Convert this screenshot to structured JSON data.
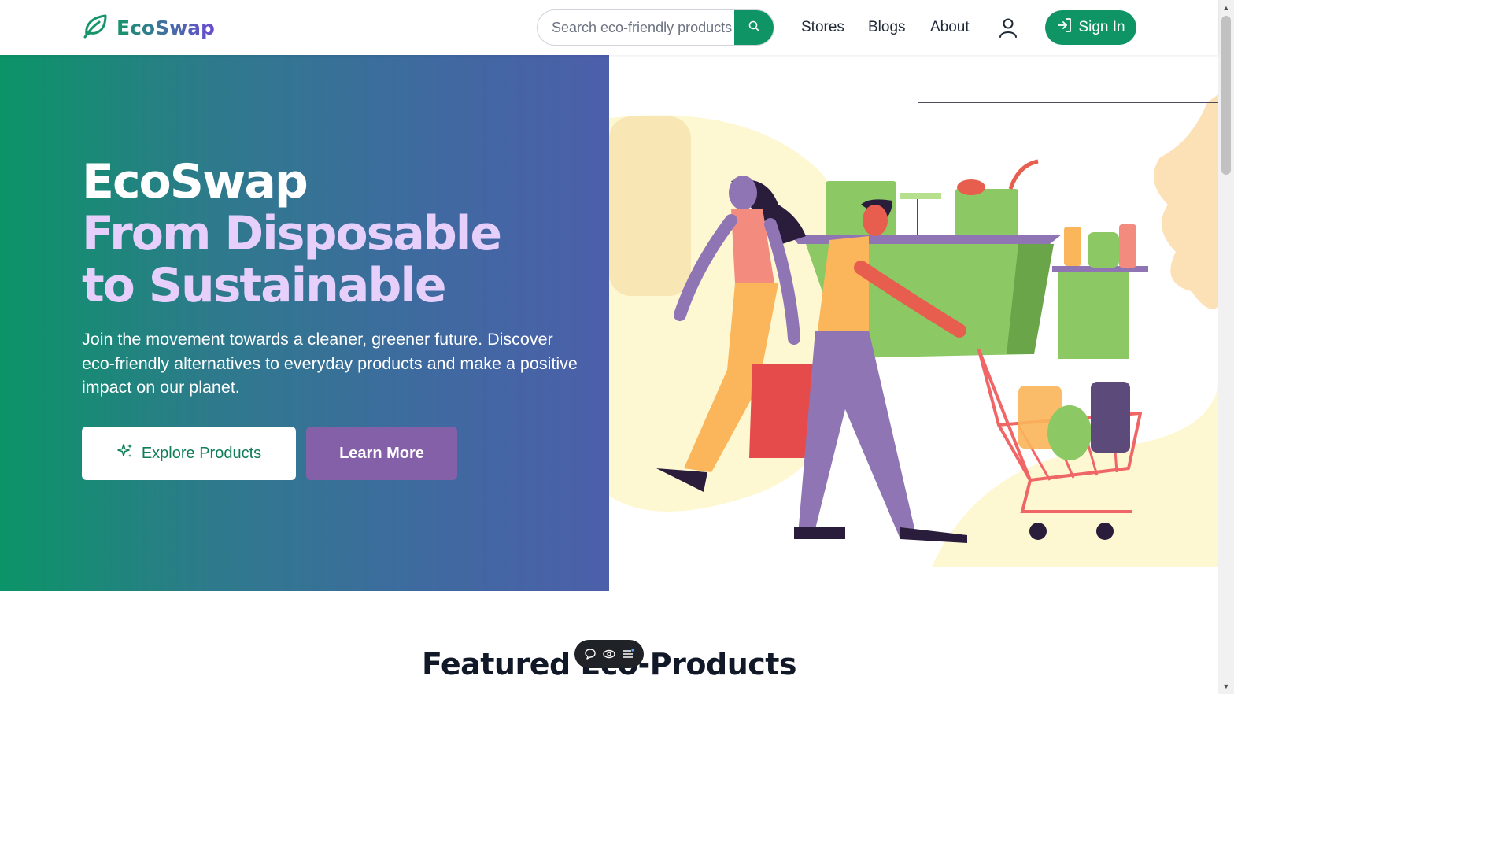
{
  "brand": {
    "name": "EcoSwap",
    "icon": "leaf-icon"
  },
  "search": {
    "placeholder": "Search eco-friendly products",
    "icon": "search-icon"
  },
  "nav": {
    "stores": "Stores",
    "blogs": "Blogs",
    "about": "About",
    "user_icon": "user-icon"
  },
  "signin": {
    "label": "Sign In",
    "icon": "login-icon"
  },
  "hero": {
    "title_line1": "EcoSwap",
    "title_line2": "From Disposable",
    "title_line3": "to Sustainable",
    "description": "Join the movement towards a cleaner, greener future. Discover eco-friendly alternatives to everyday products and make a positive impact on our planet.",
    "explore_label": "Explore Products",
    "explore_icon": "sparkles-icon",
    "learn_label": "Learn More",
    "illustration": "shopping-illustration"
  },
  "featured": {
    "title": "Featured Eco-Products"
  },
  "floating_toolbar": {
    "icons": [
      "comment-icon",
      "eye-icon",
      "menu-icon"
    ]
  },
  "colors": {
    "primary": "#0f9466",
    "accent": "#8460a8",
    "title_highlight": "#e6d0fb"
  }
}
